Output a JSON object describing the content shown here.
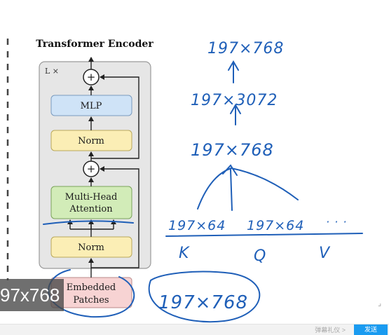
{
  "diagram": {
    "title": "Transformer Encoder",
    "repeat_label": "L ×",
    "add_symbol": "+",
    "blocks": {
      "mlp": "MLP",
      "norm_top": "Norm",
      "mha_line1": "Multi-Head",
      "mha_line2": "Attention",
      "norm_bottom": "Norm",
      "embedded_line1": "Embedded",
      "embedded_line2": "Patches"
    }
  },
  "annotations": {
    "top_shape": "197×768",
    "mlp_shape": "197×3072",
    "attn_shape": "197×768",
    "k_shape": "197×64",
    "q_shape": "197×64",
    "ellipsis": "· · ·",
    "k_label": "K",
    "q_label": "Q",
    "v_label": "V",
    "input_shape": "197×768"
  },
  "overlay": {
    "label": "97x768"
  },
  "bottom_bar": {
    "text": "弹幕礼仪 >",
    "send_label": "发送"
  },
  "icons": {
    "corner": "resize-icon"
  },
  "colors": {
    "encoder_bg": "#e6e6e6",
    "mlp_fill": "#cfe3f7",
    "norm_fill": "#fbeeb5",
    "attention_fill": "#d2ecb8",
    "embed_fill": "#f7d3d3",
    "ink": "#1f5fb8"
  }
}
